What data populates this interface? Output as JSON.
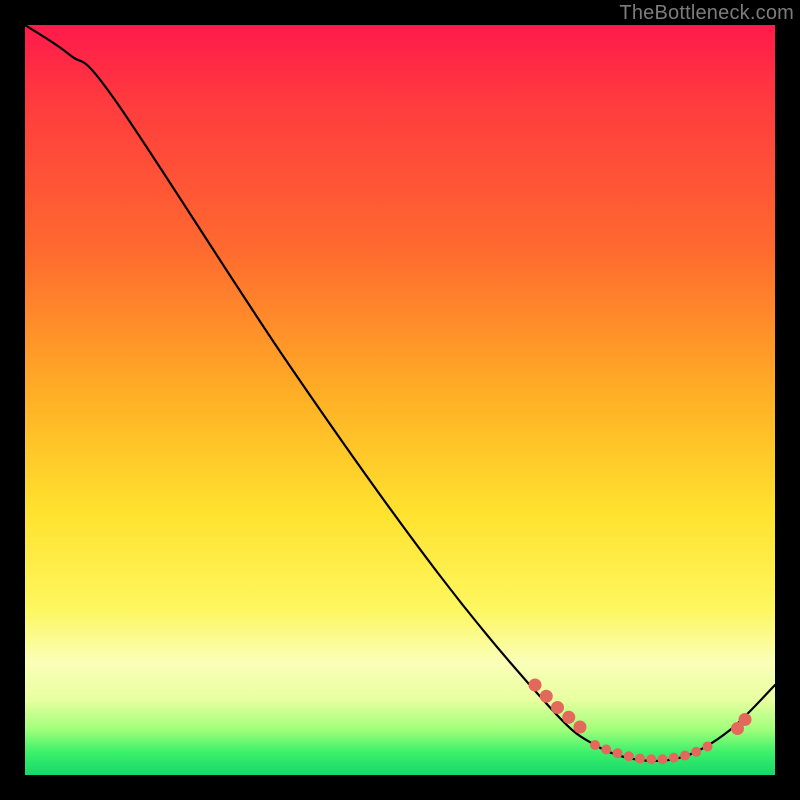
{
  "watermark": "TheBottleneck.com",
  "chart_data": {
    "type": "line",
    "title": "",
    "xlabel": "",
    "ylabel": "",
    "xlim": [
      0,
      100
    ],
    "ylim": [
      0,
      100
    ],
    "grid": false,
    "legend": false,
    "curve": [
      {
        "x": 0,
        "y": 100
      },
      {
        "x": 6,
        "y": 96
      },
      {
        "x": 12,
        "y": 90
      },
      {
        "x": 35,
        "y": 55
      },
      {
        "x": 55,
        "y": 27
      },
      {
        "x": 70,
        "y": 9
      },
      {
        "x": 76,
        "y": 4
      },
      {
        "x": 82,
        "y": 2
      },
      {
        "x": 88,
        "y": 2.5
      },
      {
        "x": 94,
        "y": 6
      },
      {
        "x": 100,
        "y": 12
      }
    ],
    "dots_coarse": [
      {
        "x": 68,
        "y": 12
      },
      {
        "x": 69.5,
        "y": 10.5
      },
      {
        "x": 71,
        "y": 9
      },
      {
        "x": 72.5,
        "y": 7.7
      },
      {
        "x": 74,
        "y": 6.4
      },
      {
        "x": 95,
        "y": 6.2
      },
      {
        "x": 96,
        "y": 7.4
      }
    ],
    "dots_fine": [
      {
        "x": 76,
        "y": 4.0
      },
      {
        "x": 77.5,
        "y": 3.4
      },
      {
        "x": 79,
        "y": 2.9
      },
      {
        "x": 80.5,
        "y": 2.5
      },
      {
        "x": 82,
        "y": 2.2
      },
      {
        "x": 83.5,
        "y": 2.1
      },
      {
        "x": 85,
        "y": 2.1
      },
      {
        "x": 86.5,
        "y": 2.3
      },
      {
        "x": 88,
        "y": 2.6
      },
      {
        "x": 89.5,
        "y": 3.1
      },
      {
        "x": 91,
        "y": 3.8
      }
    ],
    "background_gradient": {
      "top": "#ff1a4b",
      "mid_upper": "#ff6a2f",
      "mid": "#ffe22e",
      "mid_lower": "#faffb8",
      "bottom": "#14d86b"
    },
    "dot_color": "#e2695c"
  }
}
